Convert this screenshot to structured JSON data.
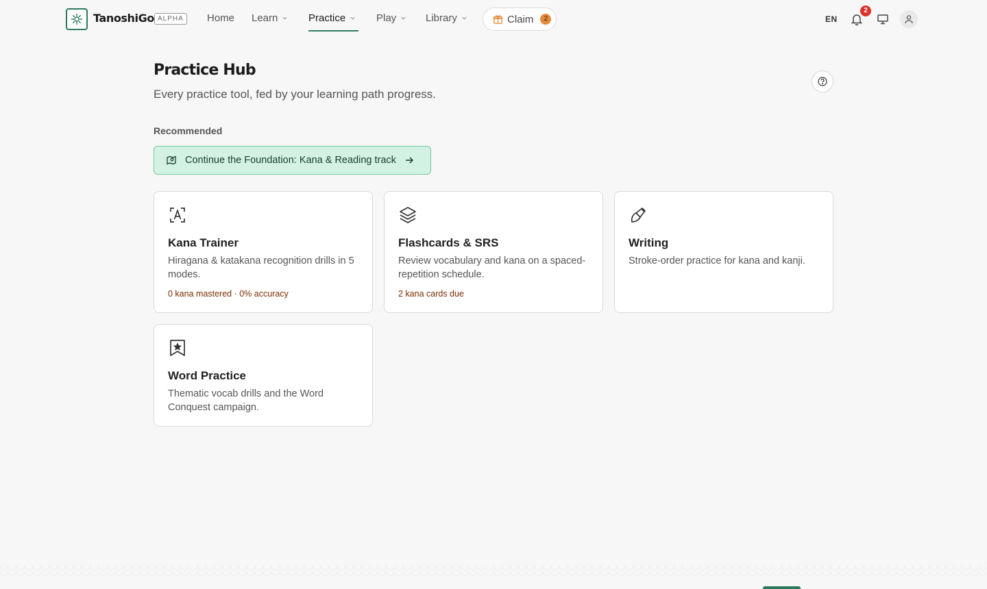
{
  "header": {
    "brand": "TanoshiGo",
    "badge": "ALPHA",
    "nav": [
      {
        "label": "Home",
        "has_dropdown": false
      },
      {
        "label": "Learn",
        "has_dropdown": true
      },
      {
        "label": "Practice",
        "has_dropdown": true,
        "active": true
      },
      {
        "label": "Play",
        "has_dropdown": true
      },
      {
        "label": "Library",
        "has_dropdown": true
      }
    ],
    "claim": {
      "label": "Claim",
      "count": "2"
    },
    "language": "EN",
    "notifications_count": "2"
  },
  "page": {
    "title": "Practice Hub",
    "subtitle": "Every practice tool, fed by your learning path progress.",
    "recommended_label": "Recommended",
    "recommended_action": "Continue the Foundation: Kana & Reading track"
  },
  "cards": [
    {
      "icon": "kana-icon",
      "title": "Kana Trainer",
      "description": "Hiragana & katakana recognition drills in 5 modes.",
      "stat": "0 kana mastered · 0% accuracy"
    },
    {
      "icon": "layers-icon",
      "title": "Flashcards & SRS",
      "description": "Review vocabulary and kana on a spaced-repetition schedule.",
      "stat": "2 kana cards due"
    },
    {
      "icon": "brush-icon",
      "title": "Writing",
      "description": "Stroke-order practice for kana and kanji.",
      "stat": ""
    },
    {
      "icon": "bookmark-star-icon",
      "title": "Word Practice",
      "description": "Thematic vocab drills and the Word Conquest campaign.",
      "stat": ""
    }
  ],
  "colors": {
    "accent": "#2d7a5f",
    "recommended_bg": "#d3f2e3",
    "stat_text": "#7a2d00",
    "badge_red": "#d9332b",
    "claim_orange": "#e58a3a"
  }
}
